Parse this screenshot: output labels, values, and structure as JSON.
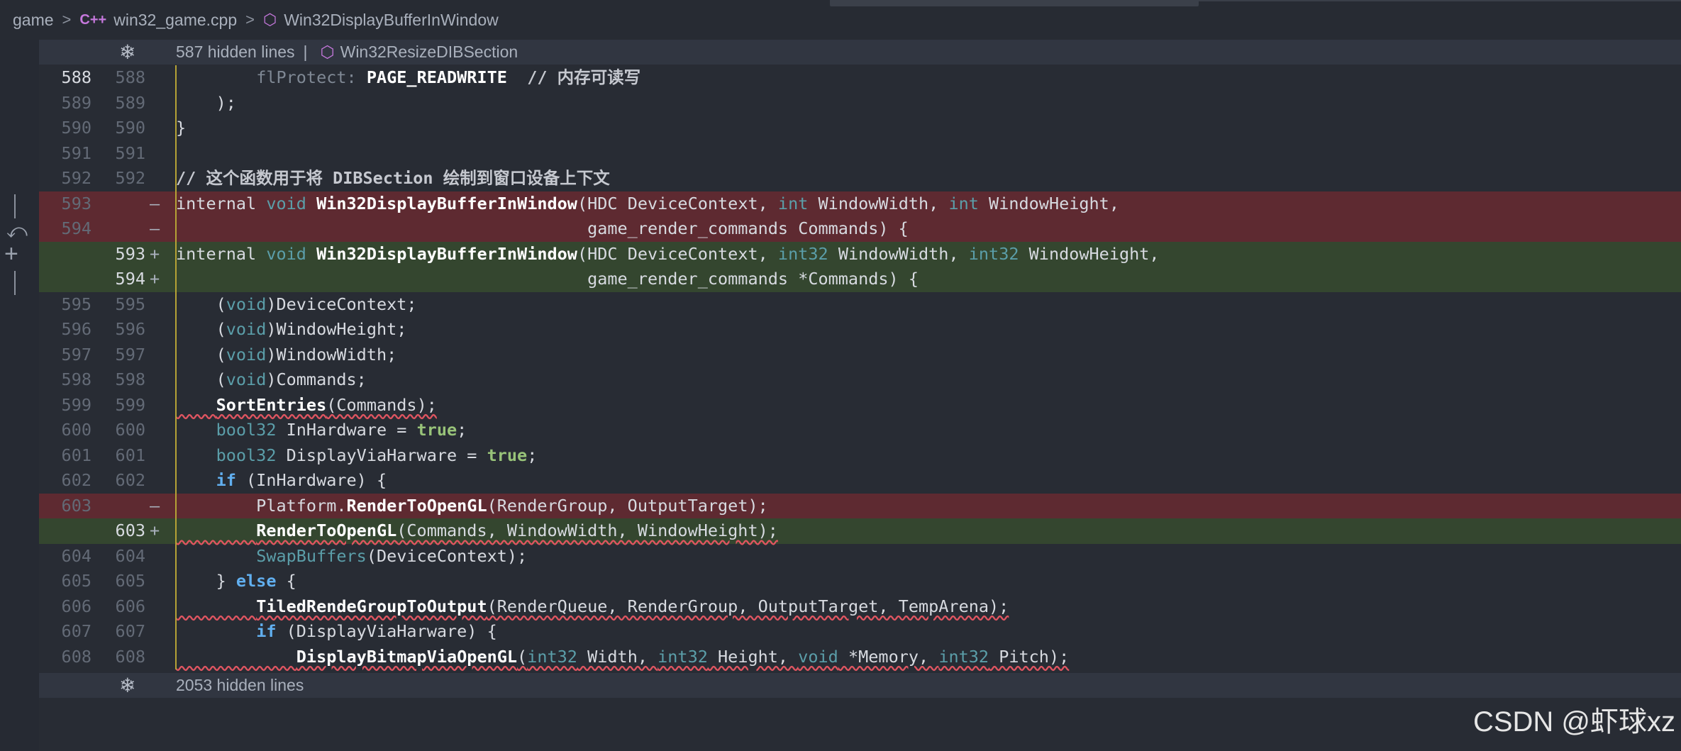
{
  "breadcrumb": {
    "folder": "game",
    "lang": "C++",
    "file": "win32_game.cpp",
    "symbol": "Win32DisplayBufferInWindow"
  },
  "folds": {
    "top": {
      "text": "587 hidden lines",
      "sep": "|",
      "symbol": "Win32ResizeDIBSection"
    },
    "bottom": {
      "text": "2053 hidden lines"
    }
  },
  "lines": [
    {
      "old": "588",
      "new": "588",
      "mark": "",
      "code": "        flProtect: PAGE_READWRITE  // 内存可读写"
    },
    {
      "old": "589",
      "new": "589",
      "mark": "",
      "code": "    );"
    },
    {
      "old": "590",
      "new": "590",
      "mark": "",
      "code": "}"
    },
    {
      "old": "591",
      "new": "591",
      "mark": "",
      "code": ""
    },
    {
      "old": "592",
      "new": "592",
      "mark": "",
      "code": "// 这个函数用于将 DIBSection 绘制到窗口设备上下文"
    },
    {
      "old": "593",
      "new": "",
      "mark": "—",
      "code": "internal void Win32DisplayBufferInWindow(HDC DeviceContext, int WindowWidth, int WindowHeight,"
    },
    {
      "old": "594",
      "new": "",
      "mark": "—",
      "code": "                                         game_render_commands Commands) {"
    },
    {
      "old": "",
      "new": "593",
      "mark": "+",
      "code": "internal void Win32DisplayBufferInWindow(HDC DeviceContext, int32 WindowWidth, int32 WindowHeight,"
    },
    {
      "old": "",
      "new": "594",
      "mark": "+",
      "code": "                                         game_render_commands *Commands) {"
    },
    {
      "old": "595",
      "new": "595",
      "mark": "",
      "code": "    (void)DeviceContext;"
    },
    {
      "old": "596",
      "new": "596",
      "mark": "",
      "code": "    (void)WindowHeight;"
    },
    {
      "old": "597",
      "new": "597",
      "mark": "",
      "code": "    (void)WindowWidth;"
    },
    {
      "old": "598",
      "new": "598",
      "mark": "",
      "code": "    (void)Commands;"
    },
    {
      "old": "599",
      "new": "599",
      "mark": "",
      "code": "    SortEntries(Commands);"
    },
    {
      "old": "600",
      "new": "600",
      "mark": "",
      "code": "    bool32 InHardware = true;"
    },
    {
      "old": "601",
      "new": "601",
      "mark": "",
      "code": "    bool32 DisplayViaHarware = true;"
    },
    {
      "old": "602",
      "new": "602",
      "mark": "",
      "code": "    if (InHardware) {"
    },
    {
      "old": "603",
      "new": "",
      "mark": "—",
      "code": "        Platform.RenderToOpenGL(RenderGroup, OutputTarget);"
    },
    {
      "old": "",
      "new": "603",
      "mark": "+",
      "code": "        RenderToOpenGL(Commands, WindowWidth, WindowHeight);"
    },
    {
      "old": "604",
      "new": "604",
      "mark": "",
      "code": "        SwapBuffers(DeviceContext);"
    },
    {
      "old": "605",
      "new": "605",
      "mark": "",
      "code": "    } else {"
    },
    {
      "old": "606",
      "new": "606",
      "mark": "",
      "code": "        TiledRendeGroupToOutput(RenderQueue, RenderGroup, OutputTarget, TempArena);"
    },
    {
      "old": "607",
      "new": "607",
      "mark": "",
      "code": "        if (DisplayViaHarware) {"
    },
    {
      "old": "608",
      "new": "608",
      "mark": "",
      "code": "            DisplayBitmapViaOpenGL(int32 Width, int32 Height, void *Memory, int32 Pitch);"
    }
  ],
  "watermark": "CSDN @虾球xz"
}
